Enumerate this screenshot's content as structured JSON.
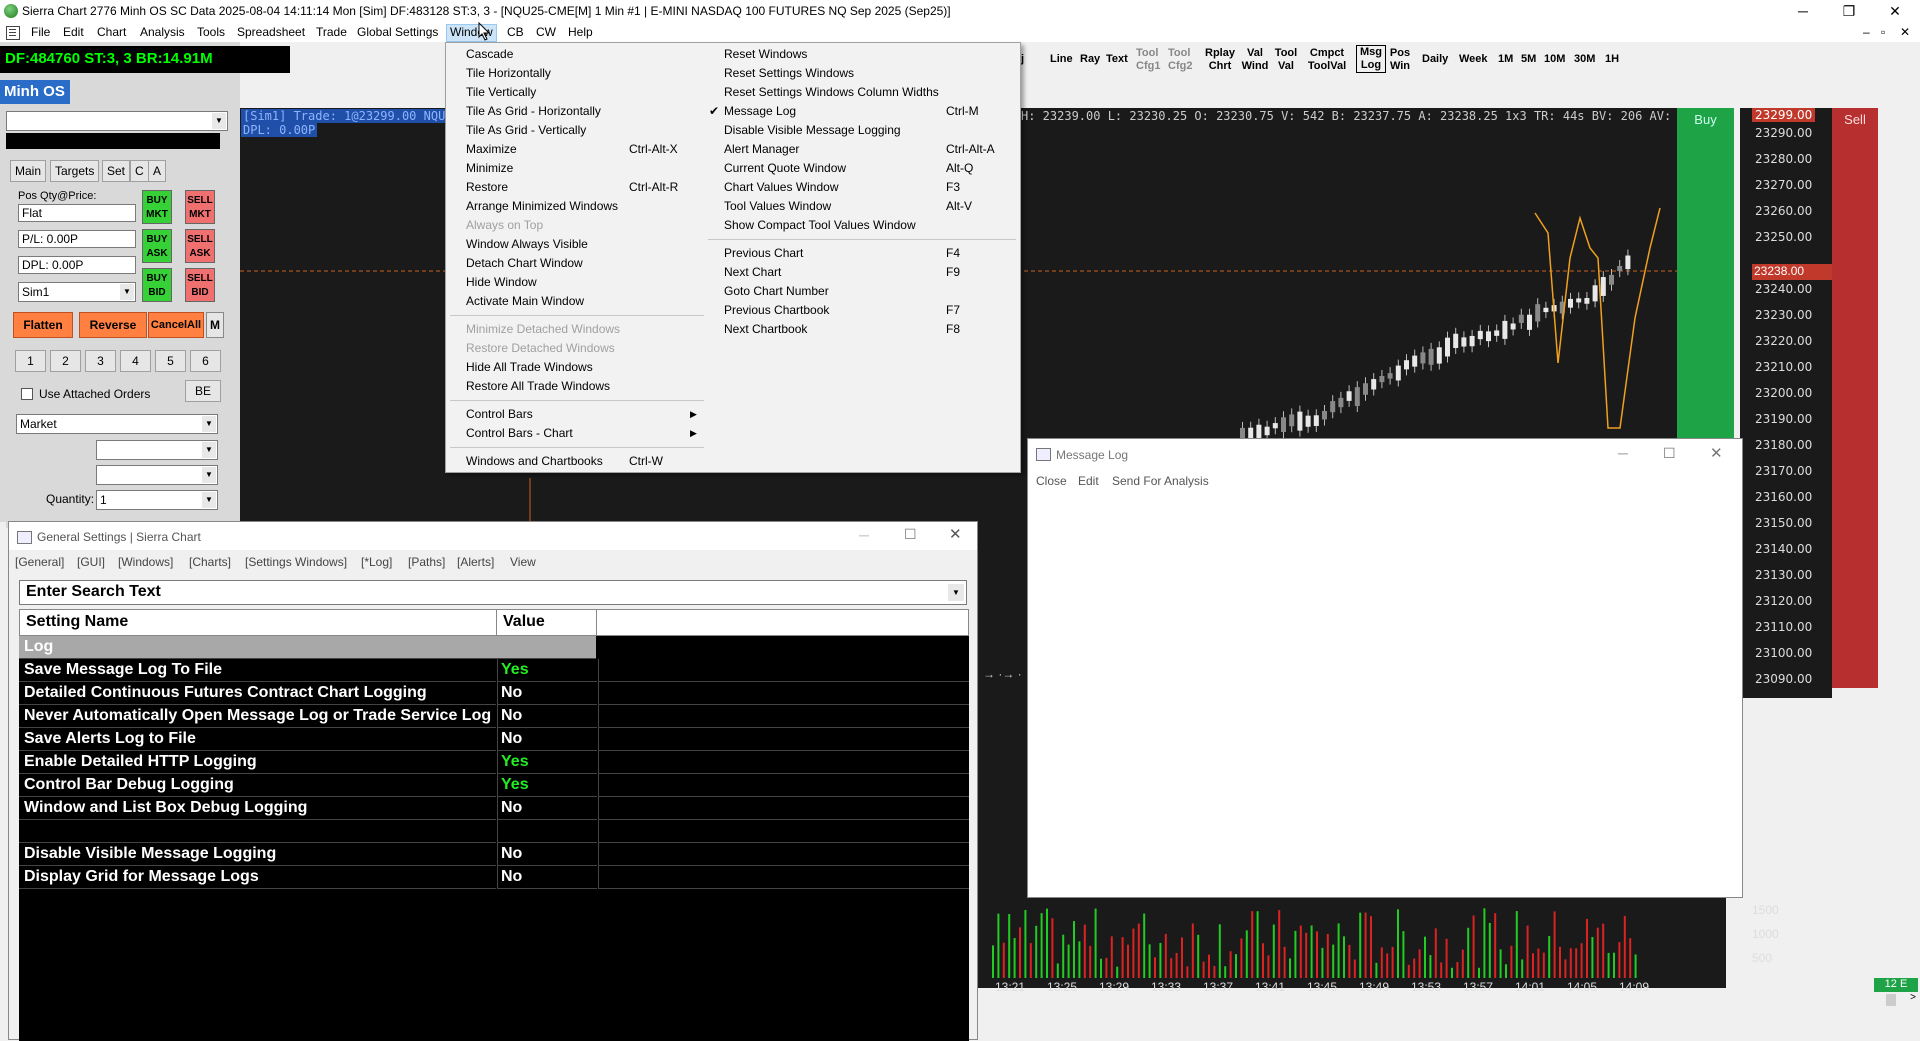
{
  "window": {
    "title": "Sierra Chart 2776 Minh OS SC Data 2025-08-04  14:11:14 Mon [Sim] DF:483128  ST:3, 3 - [NQU25-CME[M]  1 Min  #1 | E-MINI NASDAQ 100 FUTURES NQ Sep 2025 (Sep25)]",
    "minimize": "─",
    "restore": "❐",
    "close": "✕"
  },
  "menubar": [
    "File",
    "Edit",
    "Chart",
    "Analysis",
    "Tools",
    "Spreadsheet",
    "Trade",
    "Global Settings",
    "Window",
    "CB",
    "CW",
    "Help"
  ],
  "status_bar": "DF:484760  ST:3, 3  BR:14.91M",
  "account_title": "Minh OS",
  "trade_panel": {
    "tabs": [
      "Main",
      "Targets",
      "Set",
      "C",
      "A"
    ],
    "pos_label": "Pos Qty@Price:",
    "pos_value": "Flat",
    "pl": "P/L: 0.00P",
    "dpl": "DPL: 0.00P",
    "account": "Sim1",
    "buy_mkt": "BUY MKT",
    "sell_mkt": "SELL MKT",
    "buy_ask": "BUY ASK",
    "sell_ask": "SELL ASK",
    "buy_bid": "BUY BID",
    "sell_bid": "SELL BID",
    "flatten": "Flatten",
    "reverse": "Reverse",
    "cancel_all": "CancelAll",
    "m": "M",
    "qty_buttons": [
      "1",
      "2",
      "3",
      "4",
      "5",
      "6"
    ],
    "use_attached": "Use Attached Orders",
    "be": "BE",
    "order_type": "Market",
    "quantity_label": "Quantity:",
    "quantity_value": "1"
  },
  "chart": {
    "info_line1": "[Sim1]  Trade: 1@23299.00 NQU",
    "info_line2": "DPL: 0.00P",
    "ohlc": "H: 23239.00 L: 23230.25 O: 23230.75 V: 542 B: 23237.75 A: 23238.25 1x3 TR: 44s BV: 206 AV: 33",
    "buy_label": "Buy",
    "sell_label": "Sell",
    "prices": [
      "23290.00",
      "23280.00",
      "23270.00",
      "23260.00",
      "23250.00",
      "23240.00",
      "23230.00",
      "23220.00",
      "23210.00",
      "23200.00",
      "23190.00",
      "23180.00",
      "23170.00",
      "23160.00",
      "23150.00",
      "23140.00",
      "23130.00",
      "23120.00",
      "23110.00",
      "23100.00",
      "23090.00"
    ],
    "top_price": "23299.00",
    "current_price": "23238.00",
    "volume_labels": [
      "1500",
      "1000",
      "500"
    ],
    "times": [
      "13:21",
      "13:25",
      "13:29",
      "13:33",
      "13:37",
      "13:41",
      "13:45",
      "13:49",
      "13:53",
      "13:57",
      "14:01",
      "14:05",
      "14:09"
    ],
    "badge": "12 E"
  },
  "toolbar": {
    "items": [
      "Line",
      "Ray",
      "Text",
      "Tool Cfg1",
      "Tool Cfg2",
      "Rplay Chrt",
      "Val Wind",
      "Tool Val",
      "Cmpct ToolVal",
      "Msg Log",
      "Pos Win",
      "Daily",
      "Week",
      "1M",
      "5M",
      "10M",
      "30M",
      "1H"
    ]
  },
  "window_menu": {
    "left": [
      {
        "label": "Cascade",
        "shortcut": ""
      },
      {
        "label": "Tile Horizontally",
        "shortcut": ""
      },
      {
        "label": "Tile Vertically",
        "shortcut": ""
      },
      {
        "label": "Tile As Grid - Horizontally",
        "shortcut": ""
      },
      {
        "label": "Tile As Grid - Vertically",
        "shortcut": ""
      },
      {
        "label": "Maximize",
        "shortcut": "Ctrl-Alt-X"
      },
      {
        "label": "Minimize",
        "shortcut": ""
      },
      {
        "label": "Restore",
        "shortcut": "Ctrl-Alt-R"
      },
      {
        "label": "Arrange Minimized Windows",
        "shortcut": ""
      },
      {
        "label": "Always on Top",
        "shortcut": ""
      },
      {
        "label": "Window Always Visible",
        "shortcut": ""
      },
      {
        "label": "Detach Chart Window",
        "shortcut": ""
      },
      {
        "label": "Hide Window",
        "shortcut": ""
      },
      {
        "label": "Activate Main Window",
        "shortcut": ""
      },
      {
        "label": "Minimize Detached Windows",
        "shortcut": ""
      },
      {
        "label": "Restore Detached Windows",
        "shortcut": ""
      },
      {
        "label": "Hide All Trade Windows",
        "shortcut": ""
      },
      {
        "label": "Restore All Trade Windows",
        "shortcut": ""
      },
      {
        "label": "Control Bars",
        "shortcut": ""
      },
      {
        "label": "Control Bars - Chart",
        "shortcut": ""
      },
      {
        "label": "Windows and Chartbooks",
        "shortcut": "Ctrl-W"
      }
    ],
    "right": [
      {
        "label": "Reset Windows",
        "shortcut": ""
      },
      {
        "label": "Reset Settings Windows",
        "shortcut": ""
      },
      {
        "label": "Reset Settings Windows Column Widths",
        "shortcut": ""
      },
      {
        "label": "Message Log",
        "shortcut": "Ctrl-M"
      },
      {
        "label": "Disable Visible Message Logging",
        "shortcut": ""
      },
      {
        "label": "Alert Manager",
        "shortcut": "Ctrl-Alt-A"
      },
      {
        "label": "Current Quote Window",
        "shortcut": "Alt-Q"
      },
      {
        "label": "Chart Values Window",
        "shortcut": "F3"
      },
      {
        "label": "Tool Values Window",
        "shortcut": "Alt-V"
      },
      {
        "label": "Show Compact Tool Values Window",
        "shortcut": ""
      },
      {
        "label": "Previous Chart",
        "shortcut": "F4"
      },
      {
        "label": "Next Chart",
        "shortcut": "F9"
      },
      {
        "label": "Goto Chart Number",
        "shortcut": ""
      },
      {
        "label": "Previous Chartbook",
        "shortcut": "F7"
      },
      {
        "label": "Next Chartbook",
        "shortcut": "F8"
      }
    ]
  },
  "message_log": {
    "title": "Message Log",
    "menu": [
      "Close",
      "Edit",
      "Send For Analysis"
    ]
  },
  "general_settings": {
    "title": "General Settings | Sierra Chart",
    "tabs": [
      "[General]",
      "[GUI]",
      "[Windows]",
      "[Charts]",
      "[Settings Windows]",
      "[*Log]",
      "[Paths]",
      "[Alerts]",
      "View"
    ],
    "search_placeholder": "Enter Search Text",
    "col_name": "Setting Name",
    "col_value": "Value",
    "section": "Log",
    "rows": [
      {
        "name": "Save Message Log To File",
        "value": "Yes"
      },
      {
        "name": "Detailed Continuous Futures Contract Chart Logging",
        "value": "No"
      },
      {
        "name": "Never Automatically Open Message Log or Trade Service Log",
        "value": "No"
      },
      {
        "name": "Save Alerts Log to File",
        "value": "No"
      },
      {
        "name": "Enable Detailed HTTP Logging",
        "value": "Yes"
      },
      {
        "name": "Control Bar Debug Logging",
        "value": "Yes"
      },
      {
        "name": "Window and List Box Debug Logging",
        "value": "No"
      },
      {
        "name": "",
        "value": ""
      },
      {
        "name": "Disable Visible Message Logging",
        "value": "No"
      },
      {
        "name": "Display Grid for Message Logs",
        "value": "No"
      }
    ]
  }
}
